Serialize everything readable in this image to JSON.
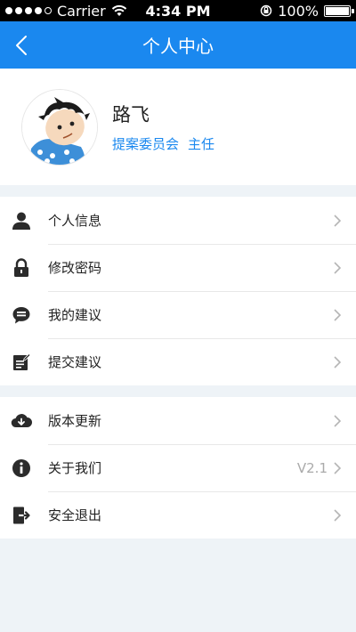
{
  "status_bar": {
    "carrier": "Carrier",
    "time": "4:34 PM",
    "battery": "100%"
  },
  "nav": {
    "title": "个人中心"
  },
  "profile": {
    "name": "路飞",
    "department": "提案委员会",
    "position": "主任"
  },
  "menu_group_1": [
    {
      "label": "个人信息",
      "icon": "user-icon"
    },
    {
      "label": "修改密码",
      "icon": "lock-icon"
    },
    {
      "label": "我的建议",
      "icon": "chat-bubble-icon"
    },
    {
      "label": "提交建议",
      "icon": "edit-note-icon"
    }
  ],
  "menu_group_2": [
    {
      "label": "版本更新",
      "icon": "cloud-download-icon"
    },
    {
      "label": "关于我们",
      "icon": "info-icon",
      "value": "V2.1"
    },
    {
      "label": "安全退出",
      "icon": "logout-icon"
    }
  ],
  "colors": {
    "primary": "#1a88ef",
    "background": "#eef3f7"
  }
}
